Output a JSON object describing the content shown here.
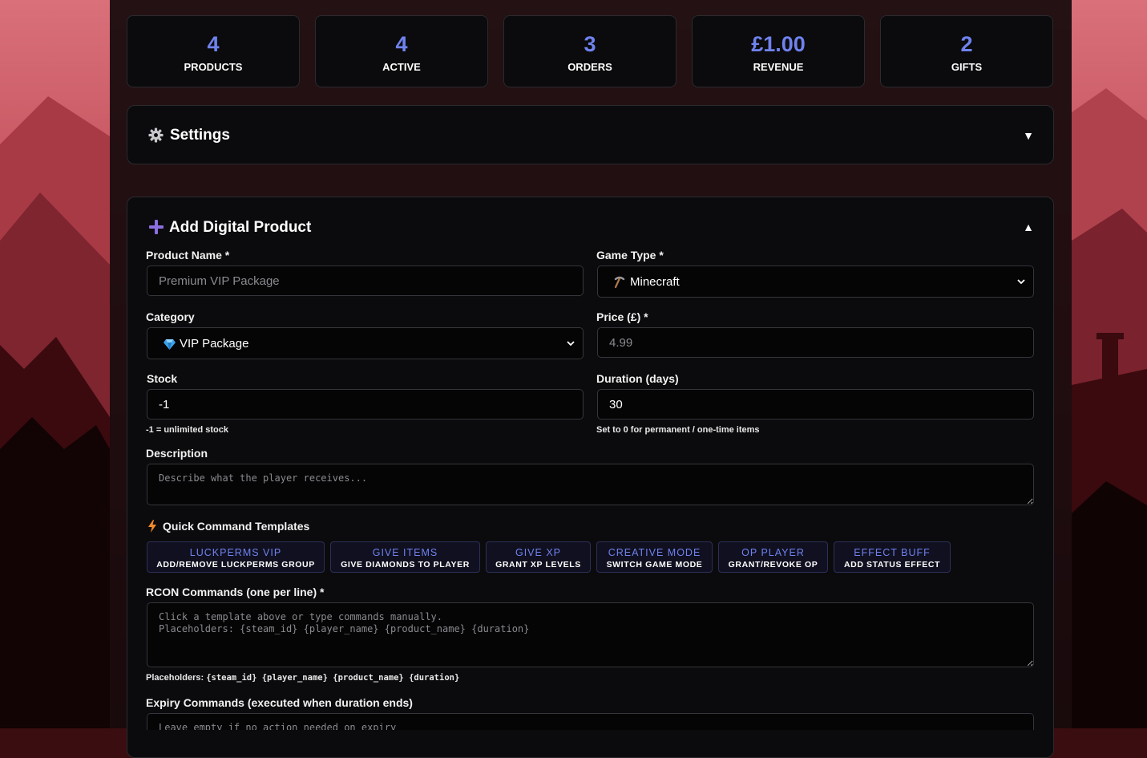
{
  "stats": [
    {
      "value": "4",
      "label": "PRODUCTS"
    },
    {
      "value": "4",
      "label": "ACTIVE"
    },
    {
      "value": "3",
      "label": "ORDERS"
    },
    {
      "value": "£1.00",
      "label": "REVENUE"
    },
    {
      "value": "2",
      "label": "GIFTS"
    }
  ],
  "settings": {
    "title": "Settings",
    "toggle_icon": "▼"
  },
  "add_product": {
    "title": "Add Digital Product",
    "toggle_icon": "▲",
    "product_name": {
      "label": "Product Name *",
      "placeholder": "Premium VIP Package",
      "value": ""
    },
    "game_type": {
      "label": "Game Type *",
      "value": "Minecraft",
      "icon": "pickaxe-icon"
    },
    "category": {
      "label": "Category",
      "value": "VIP Package",
      "icon": "gem-icon"
    },
    "price": {
      "label": "Price (£) *",
      "placeholder": "4.99",
      "value": ""
    },
    "stock": {
      "label": "Stock",
      "value": "-1",
      "hint": "-1 = unlimited stock"
    },
    "duration": {
      "label": "Duration (days)",
      "value": "30",
      "hint": "Set to 0 for permanent / one-time items"
    },
    "description": {
      "label": "Description",
      "placeholder": "Describe what the player receives..."
    },
    "quick_templates": {
      "label": "Quick Command Templates",
      "icon": "lightning-icon",
      "buttons": [
        {
          "name": "LUCKPERMS VIP",
          "desc": "ADD/REMOVE LUCKPERMS GROUP"
        },
        {
          "name": "GIVE ITEMS",
          "desc": "GIVE DIAMONDS TO PLAYER"
        },
        {
          "name": "GIVE XP",
          "desc": "GRANT XP LEVELS"
        },
        {
          "name": "CREATIVE MODE",
          "desc": "SWITCH GAME MODE"
        },
        {
          "name": "OP PLAYER",
          "desc": "GRANT/REVOKE OP"
        },
        {
          "name": "EFFECT BUFF",
          "desc": "ADD STATUS EFFECT"
        }
      ]
    },
    "rcon": {
      "label": "RCON Commands (one per line) *",
      "placeholder": "Click a template above or type commands manually.\nPlaceholders: {steam_id} {player_name} {product_name} {duration}",
      "hint_prefix": "Placeholders:",
      "hint_codes": "{steam_id} {player_name} {product_name} {duration}"
    },
    "expiry": {
      "label": "Expiry Commands (executed when duration ends)",
      "placeholder": "Leave empty if no action needed on expiry"
    }
  },
  "colors": {
    "accent": "#6f82ee",
    "purple_icon": "#8b6fe0",
    "card_bg": "#0b0b0d",
    "scene_red": "#c94a55"
  }
}
